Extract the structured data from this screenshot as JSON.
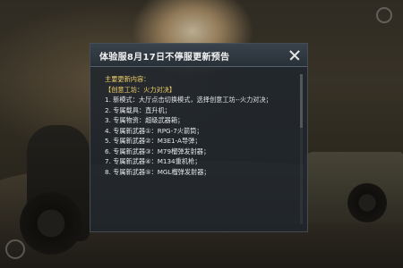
{
  "dialog": {
    "title": "体验服8月17日不停服更新预告",
    "intro": "主要更新内容：",
    "section": "【创意工坊：火力对决】",
    "items": [
      "1. 新模式：大厅点击切换模式，选择创意工坊--火力对决；",
      "2. 专属载具：直升机；",
      "3. 专属物资：超级武器箱；",
      "4. 专属新武器①：RPG-7火箭筒；",
      "5. 专属新武器②：M3E1-A导弹；",
      "6. 专属新武器③：M79榴弹发射器；",
      "7. 专属新武器④：M134重机枪；",
      "8. 专属新武器⑤：MGL榴弹发射器；"
    ],
    "close_icon": "close-icon"
  }
}
